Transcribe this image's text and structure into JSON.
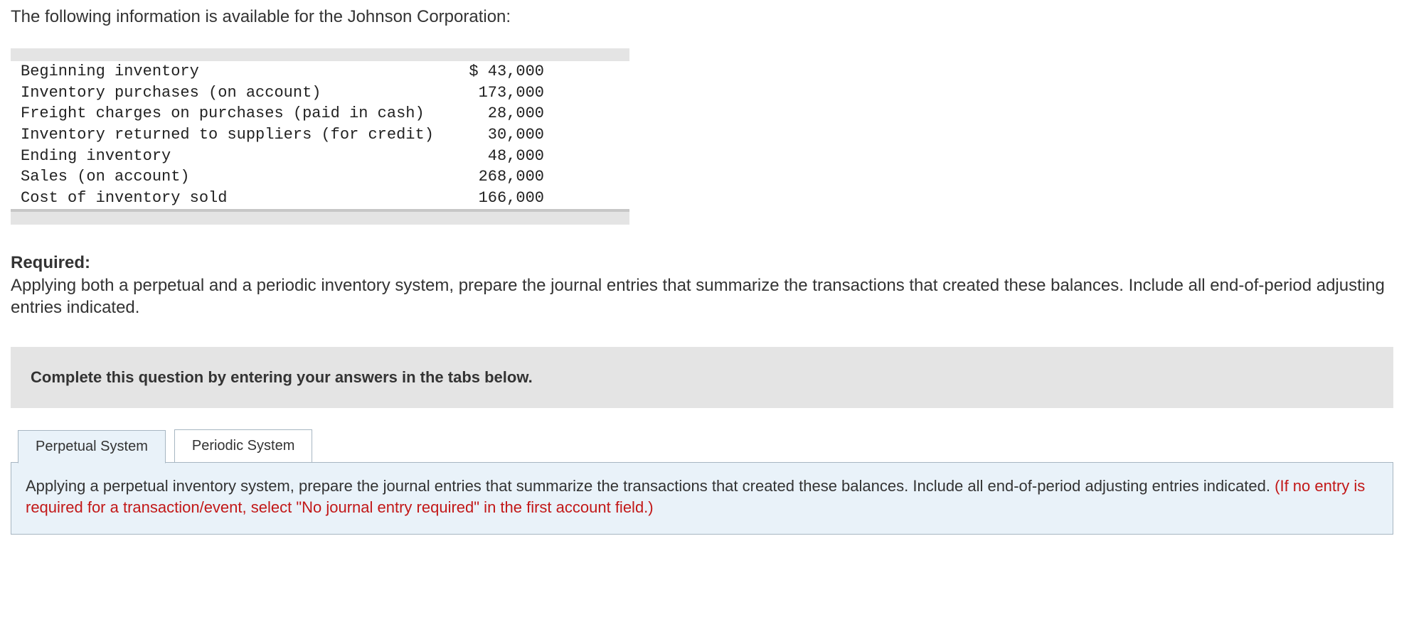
{
  "intro": "The following information is available for the Johnson Corporation:",
  "data_rows": [
    {
      "label": "Beginning inventory",
      "value": "$ 43,000"
    },
    {
      "label": "Inventory purchases (on account)",
      "value": "173,000"
    },
    {
      "label": "Freight charges on purchases (paid in cash)",
      "value": "28,000"
    },
    {
      "label": "Inventory returned to suppliers (for credit)",
      "value": "30,000"
    },
    {
      "label": "Ending inventory",
      "value": "48,000"
    },
    {
      "label": "Sales (on account)",
      "value": "268,000"
    },
    {
      "label": "Cost of inventory sold",
      "value": "166,000"
    }
  ],
  "required_heading": "Required:",
  "required_text": "Applying both a perpetual and a periodic inventory system, prepare the journal entries that summarize the transactions that created these balances. Include all end-of-period adjusting entries indicated.",
  "instruction_bar": "Complete this question by entering your answers in the tabs below.",
  "tabs": {
    "perpetual": "Perpetual System",
    "periodic": "Periodic System"
  },
  "panel": {
    "black": "Applying a perpetual inventory system, prepare the journal entries that summarize the transactions that created these balances. Include all end-of-period adjusting entries indicated. ",
    "red": "(If no entry is required for a transaction/event, select \"No journal entry required\" in the first account field.)"
  }
}
